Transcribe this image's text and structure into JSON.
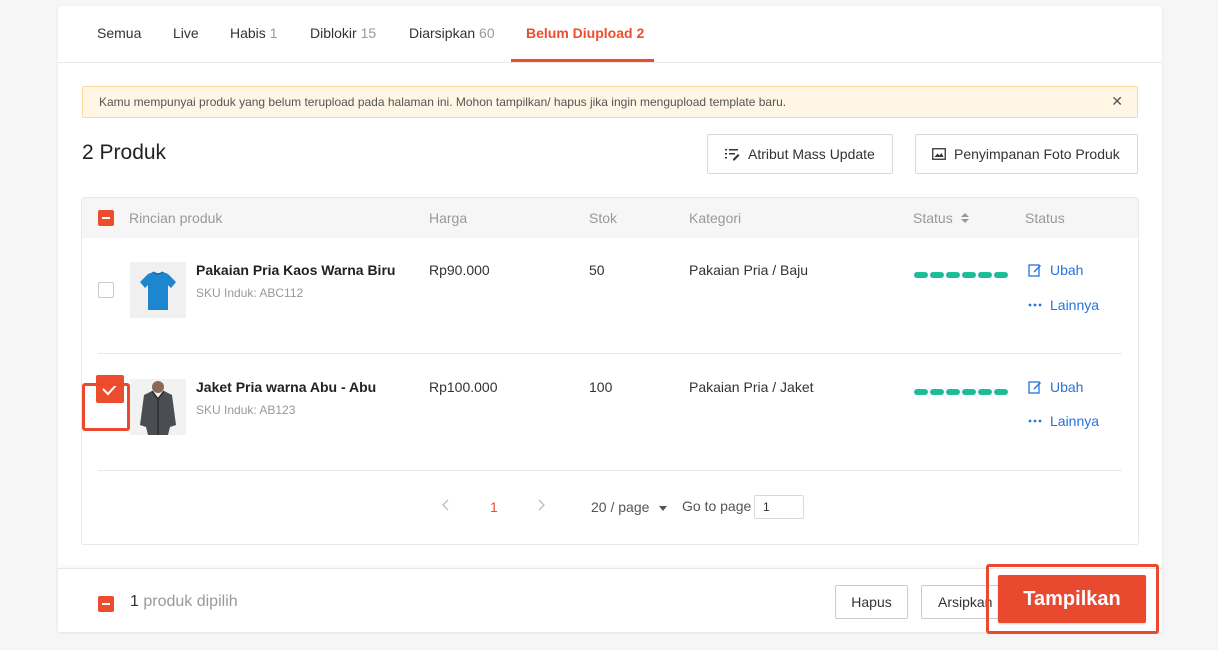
{
  "tabs": [
    {
      "label": "Semua",
      "count": ""
    },
    {
      "label": "Live",
      "count": ""
    },
    {
      "label": "Habis",
      "count": "1"
    },
    {
      "label": "Diblokir",
      "count": "15"
    },
    {
      "label": "Diarsipkan",
      "count": "60"
    },
    {
      "label": "Belum Diupload",
      "count": "2"
    }
  ],
  "notice": {
    "text": "Kamu mempunyai produk yang belum terupload pada halaman ini. Mohon tampilkan/ hapus jika ingin mengupload template baru.",
    "close": "✕"
  },
  "heading": "2 Produk",
  "toolbar": {
    "mass_update": "Atribut Mass Update",
    "photo_storage": "Penyimpanan Foto Produk"
  },
  "table": {
    "headers": [
      "Rincian produk",
      "Harga",
      "Stok",
      "Kategori",
      "Status",
      "Status"
    ],
    "status_sort_icon": "sort-icon",
    "rows": [
      {
        "name": "Pakaian Pria Kaos Warna Biru",
        "sku": "SKU Induk: ABC112",
        "price": "Rp90.000",
        "stock": "50",
        "category": "Pakaian Pria / Baju",
        "checked": false,
        "edit": "Ubah",
        "more": "Lainnya",
        "image": "blue-tshirt"
      },
      {
        "name": "Jaket Pria warna Abu - Abu",
        "sku": "SKU Induk: AB123",
        "price": "Rp100.000",
        "stock": "100",
        "category": "Pakaian Pria / Jaket",
        "checked": true,
        "edit": "Ubah",
        "more": "Lainnya",
        "image": "grey-jacket"
      }
    ]
  },
  "pagination": {
    "current": "1",
    "page_size": "20 / page",
    "goto_label": "Go to page",
    "goto_value": "1"
  },
  "footer": {
    "selected_count": "1",
    "selected_label": "produk dipilih",
    "delete": "Hapus",
    "archive": "Arsipkan",
    "show": "Tampilkan"
  },
  "colors": {
    "accent": "#ee4d2d",
    "link": "#2673dd",
    "status_bar": "#1fbb9b",
    "notice_bg": "#fff6e6"
  }
}
